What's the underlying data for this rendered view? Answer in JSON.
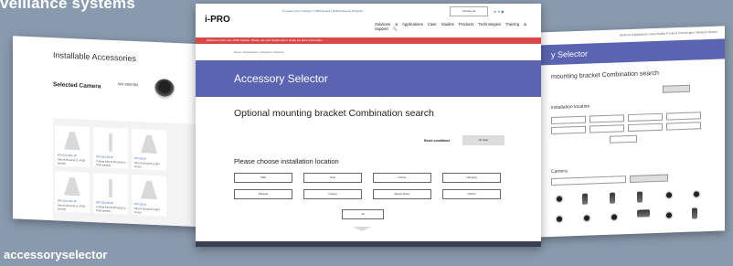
{
  "background": {
    "title": "veillance systems",
    "caption": "accessoryselector"
  },
  "left_screenshot": {
    "title": "Installable Accessories",
    "selected_camera_label": "Selected Camera",
    "camera_model": "WV-X8570N",
    "tiles": [
      {
        "line1": "WV-QCL501-W",
        "line2": "Mount Bracket (L-PSB series)"
      },
      {
        "line1": "WV-Q121B-W",
        "line2": "Ceiling Mount Bracket (L-PSB series)"
      },
      {
        "line1": "WV-Q105",
        "line2": "Mount Bracket (Light Gray)"
      },
      {
        "line1": "WV-QCL501-W",
        "line2": "Mount Bracket (L-PSB series)"
      },
      {
        "line1": "WV-Q121B-W",
        "line2": "Ceiling Mount Bracket (L-PSB series)"
      },
      {
        "line1": "WV-Q105",
        "line2": "Mount Bracket (Light Gray)"
      }
    ]
  },
  "main_screenshot": {
    "logo": "i-PRO",
    "top_links": "Company Info  |  Careers  |  i-PRO Events  |  Global Security Products",
    "contact_button": "Contact Us",
    "social": "in  ✕  ▶",
    "nav": "Solutions & Applications  Case Studies  Products  Technologies  Training & Support  🔍",
    "notice": "Welcome to the new i-PRO website. Please use your bookmarks to locate the latest information.",
    "breadcrumb": "Home  /  Accessories  /  Accessory Selector",
    "hero_title": "Accessory Selector",
    "section_title": "Optional mounting bracket Combination search",
    "reset_label": "Reset conditions",
    "reset_button": "All clear",
    "location_heading": "Please choose installation location",
    "locations_row1": [
      "Wall",
      "Pole",
      "Corner",
      "Hanging"
    ],
    "locations_row2": [
      "Parapet",
      "Ceiling",
      "Mount Down",
      "Others"
    ],
    "all_button": "All"
  },
  "right_screenshot": {
    "nav": "Solutions & Applications  Case Studies  Products  Technologies  Training & Support",
    "banner": "y Selector",
    "subtitle": "mounting bracket Combination search",
    "location_label": "installation location",
    "camera_label": "Camera"
  }
}
